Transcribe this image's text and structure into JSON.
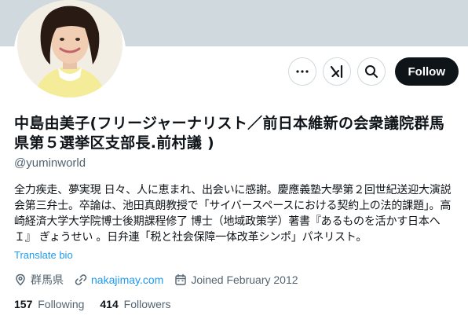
{
  "profile": {
    "display_name": "中島由美子(フリージャーナリスト／前日本維新の会衆議院群馬県第５選挙区支部長.前村議 )",
    "handle": "@yuminworld",
    "bio": "全力疾走、夢実現 日々、人に恵まれ、出会いに感謝。慶應義塾大學第２回世紀送迎大演説会第三弁士。卒論は、池田真朗教授で「サイバースペースにおける契約上の法的課題」。高崎経済大学大学院博士後期課程修了 博士（地域政策学）著書『あるものを活かす日本へＩ』 ぎょうせい 。日弁連「税と社会保障一体改革シンポ」パネリスト。",
    "translate_label": "Translate bio",
    "location": "群馬県",
    "website": "nakajimay.com",
    "joined": "Joined February 2012"
  },
  "stats": {
    "following_count": "157",
    "following_label": "Following",
    "followers_count": "414",
    "followers_label": "Followers"
  },
  "actions": {
    "follow_label": "Follow",
    "more_icon": "more-icon",
    "grok_icon": "grok-icon",
    "search_icon": "search-icon"
  },
  "colors": {
    "banner": "#cfd9de",
    "text_primary": "#0f1419",
    "text_secondary": "#536471",
    "link": "#1d9bf0",
    "follow_bg": "#0f1419"
  }
}
